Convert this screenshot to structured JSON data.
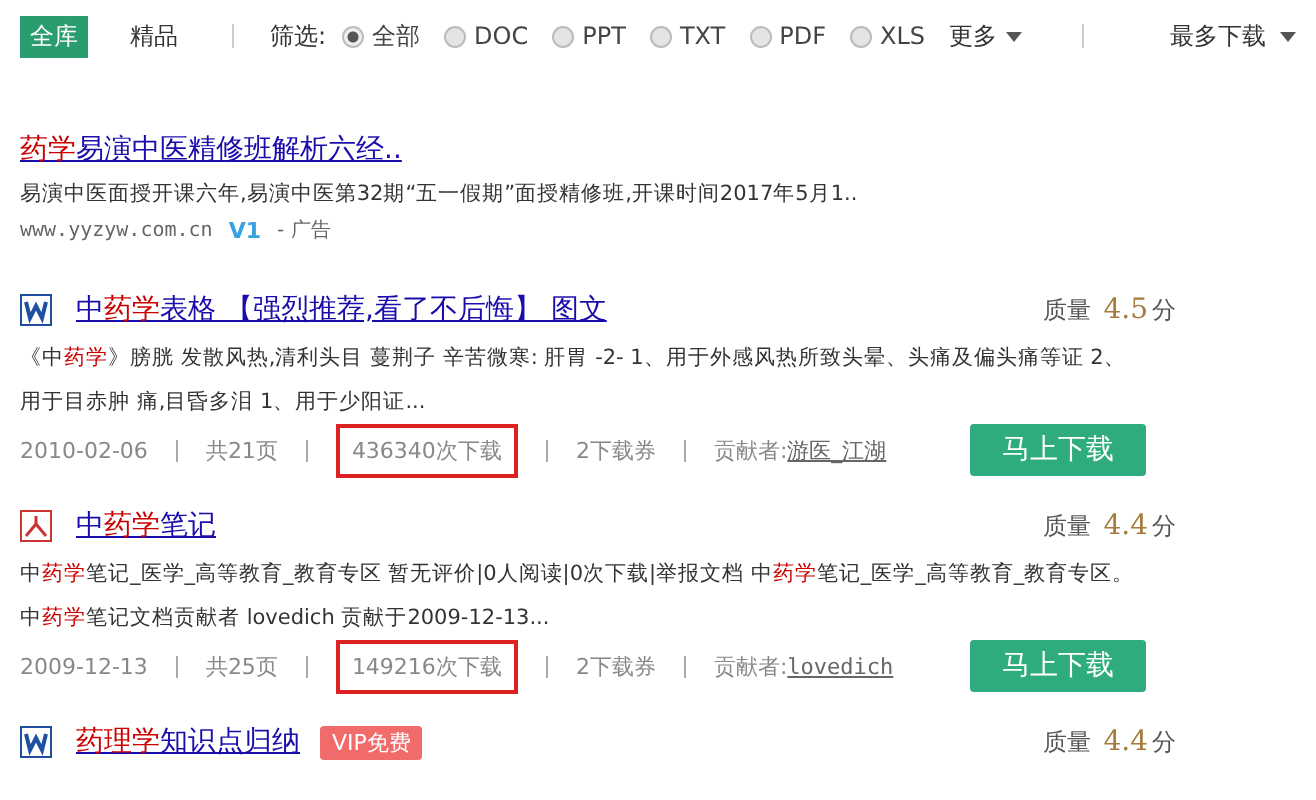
{
  "filter_bar": {
    "scopes": [
      {
        "label": "全库",
        "selected": true
      },
      {
        "label": "精品",
        "selected": false
      }
    ],
    "filter_label": "筛选:",
    "formats": [
      {
        "label": "全部",
        "selected": true
      },
      {
        "label": "DOC",
        "selected": false
      },
      {
        "label": "PPT",
        "selected": false
      },
      {
        "label": "TXT",
        "selected": false
      },
      {
        "label": "PDF",
        "selected": false
      },
      {
        "label": "XLS",
        "selected": false
      }
    ],
    "more": "更多",
    "sort": "最多下载"
  },
  "ad": {
    "title": [
      {
        "text": "药学",
        "hit": true
      },
      {
        "text": "易演中医精修班解析六经..",
        "hit": false
      }
    ],
    "description": "易演中医面授开课六年,易演中医第32期“五一假期”面授精修班,开课时间2017年5月1..",
    "url": "www.yyzyw.com.cn",
    "badge": "V1",
    "tag": "- 广告"
  },
  "results": [
    {
      "kind": "word",
      "title": [
        {
          "text": "中",
          "hit": false
        },
        {
          "text": "药学",
          "hit": true
        },
        {
          "text": "表格 【强烈推荐,看了不后悔】 图文",
          "hit": false
        }
      ],
      "quality_label": "质量",
      "score": "4.5",
      "unit": "分",
      "description": [
        {
          "text": "《中",
          "hit": false
        },
        {
          "text": "药学",
          "hit": true
        },
        {
          "text": "》膀胱 发散风热,清利头目 蔓荆子 辛苦微寒: 肝胃 -2- 1、用于外感风热所致头晕、头痛及偏头痛等证 2、用于目赤肿 痛,目昏多泪 1、用于少阳证...",
          "hit": false
        }
      ],
      "date": "2010-02-06",
      "pages": "共21页",
      "downloads": "436340次下载",
      "downloads_highlighted": true,
      "tickets": "2下载券",
      "contributor_label": "贡献者:",
      "contributor": "游医_江湖",
      "button": "马上下载"
    },
    {
      "kind": "pdf",
      "title": [
        {
          "text": "中",
          "hit": false
        },
        {
          "text": "药学",
          "hit": true
        },
        {
          "text": "笔记",
          "hit": false
        }
      ],
      "quality_label": "质量",
      "score": "4.4",
      "unit": "分",
      "description": [
        {
          "text": "中",
          "hit": false
        },
        {
          "text": "药学",
          "hit": true
        },
        {
          "text": "笔记_医学_高等教育_教育专区 暂无评价|0人阅读|0次下载|举报文档 中",
          "hit": false
        },
        {
          "text": "药学",
          "hit": true
        },
        {
          "text": "笔记_医学_高等教育_教育专区。中",
          "hit": false
        },
        {
          "text": "药学",
          "hit": true
        },
        {
          "text": "笔记文档贡献者 lovedich 贡献于2009-12-13...",
          "hit": false
        }
      ],
      "date": "2009-12-13",
      "pages": "共25页",
      "downloads": "149216次下载",
      "downloads_highlighted": true,
      "tickets": "2下载券",
      "contributor_label": "贡献者:",
      "contributor": "lovedich",
      "button": "马上下载"
    },
    {
      "kind": "word",
      "title": [
        {
          "text": "药理学",
          "hit": true
        },
        {
          "text": "知识点归纳",
          "hit": false
        }
      ],
      "vip": "VIP免费",
      "quality_label": "质量",
      "score": "4.4",
      "unit": "分"
    }
  ]
}
